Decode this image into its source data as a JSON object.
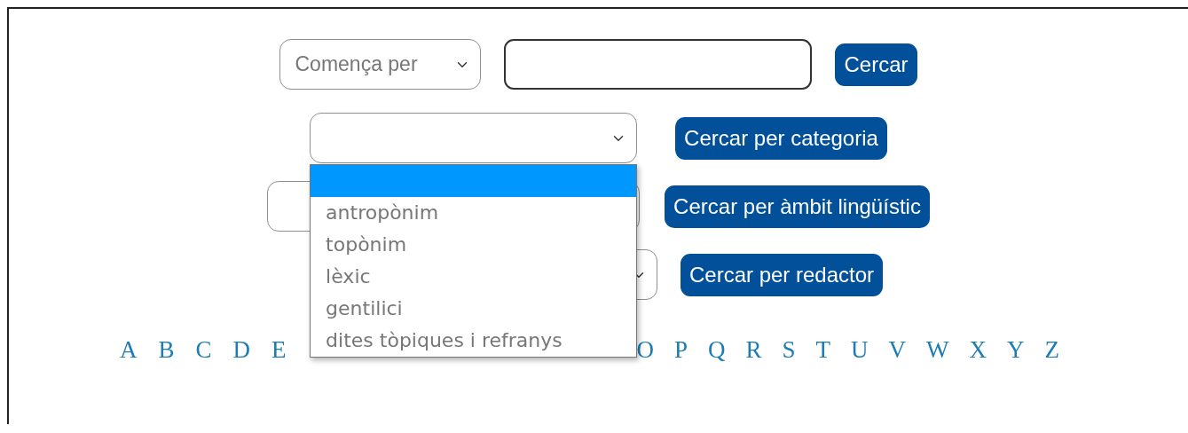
{
  "search_rows": [
    {
      "kind": "text",
      "select_value": "Comença per",
      "button": "Cercar"
    },
    {
      "kind": "category",
      "button": "Cercar per categoria",
      "dropdown_open": true
    },
    {
      "kind": "ambit",
      "button": "Cercar per àmbit lingüístic"
    },
    {
      "kind": "redactor",
      "button": "Cercar per redactor"
    }
  ],
  "category_dropdown": {
    "options": [
      {
        "selected": true
      },
      {
        "label": "antropònim",
        "selected": false
      },
      {
        "label": "topònim",
        "selected": false
      },
      {
        "label": "lèxic",
        "selected": false
      },
      {
        "label": "gentilici",
        "selected": false
      },
      {
        "label": "dites tòpiques i refranys",
        "selected": false
      }
    ]
  },
  "alphabet": {
    "before_dropdown": [
      "A",
      "B",
      "C",
      "D",
      "E"
    ],
    "after_dropdown": [
      "O",
      "P",
      "Q",
      "R",
      "S",
      "T",
      "U",
      "V",
      "W",
      "X",
      "Y",
      "Z"
    ]
  }
}
